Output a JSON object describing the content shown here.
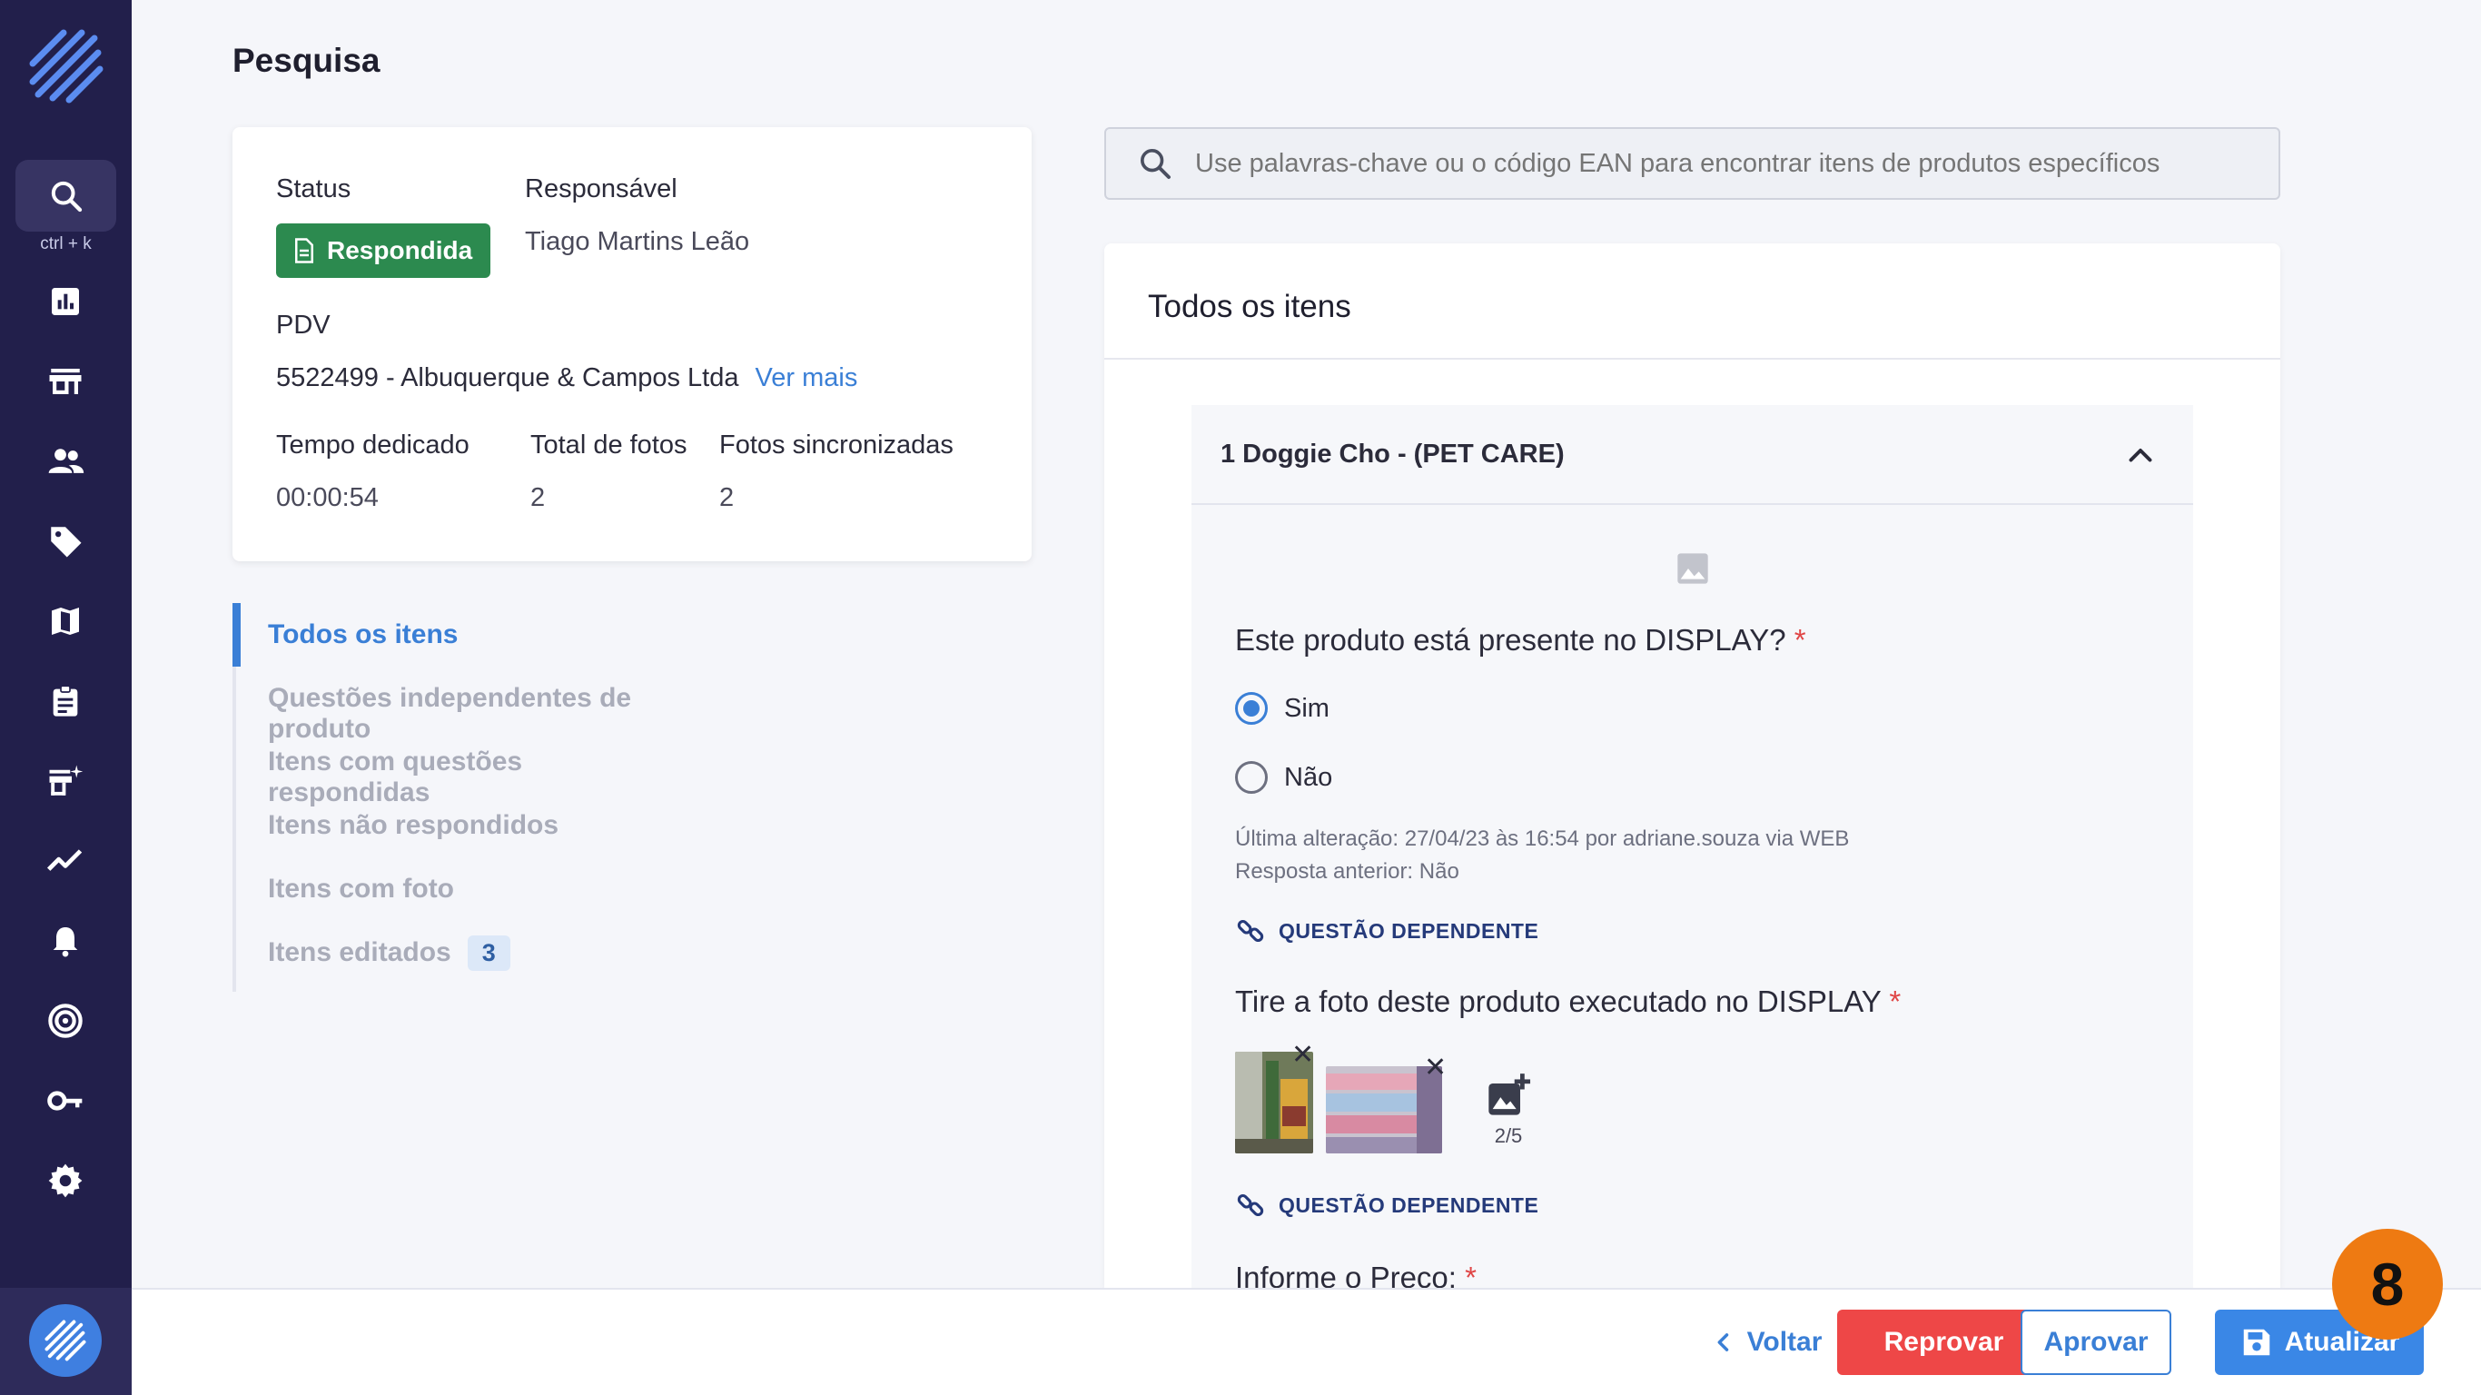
{
  "sidebar": {
    "search_hint": "ctrl + k",
    "icons": [
      "search-icon",
      "dashboard-icon",
      "store-icon",
      "people-icon",
      "tag-icon",
      "map-icon",
      "clipboard-icon",
      "add-business-icon",
      "trending-icon",
      "bell-icon",
      "target-icon",
      "key-icon",
      "gear-icon"
    ]
  },
  "page": {
    "title": "Pesquisa"
  },
  "info": {
    "status_label": "Status",
    "status_value": "Respondida",
    "responsible_label": "Responsável",
    "responsible_value": "Tiago Martins Leão",
    "pdv_label": "PDV",
    "pdv_value": "5522499 - Albuquerque & Campos Ltda",
    "pdv_link": "Ver mais",
    "time_label": "Tempo dedicado",
    "time_value": "00:00:54",
    "photos_label": "Total de fotos",
    "photos_value": "2",
    "synced_label": "Fotos sincronizadas",
    "synced_value": "2"
  },
  "nav": {
    "items": [
      "Todos os itens",
      "Questões independentes de produto",
      "Itens com questões respondidas",
      "Itens não respondidos",
      "Itens com foto",
      "Itens editados"
    ],
    "edited_count": "3"
  },
  "search": {
    "placeholder": "Use palavras-chave ou o código EAN para encontrar itens de produtos específicos"
  },
  "panel": {
    "title": "Todos os itens",
    "product": "1 Doggie Cho - (PET CARE)",
    "q1": "Este produto está presente no DISPLAY?",
    "q1_opt_yes": "Sim",
    "q1_opt_no": "Não",
    "q1_meta_1": "Última alteração: 27/04/23 às 16:54 por adriane.souza via WEB",
    "q1_meta_2": "Resposta anterior:  Não",
    "dependent_label": "QUESTÃO DEPENDENTE",
    "q2": "Tire a foto deste produto executado no DISPLAY",
    "photo_count": "2/5",
    "q3": "Informe o Preço:",
    "required_mark": "*"
  },
  "footer": {
    "back": "Voltar",
    "reject": "Reprovar",
    "approve": "Aprovar",
    "update": "Atualizar"
  },
  "step_badge": "8",
  "colors": {
    "sidebar": "#221f4b",
    "accent": "#3a7fd6",
    "success": "#2c8a4f",
    "danger": "#ee4747",
    "badge": "#ee7a12"
  }
}
